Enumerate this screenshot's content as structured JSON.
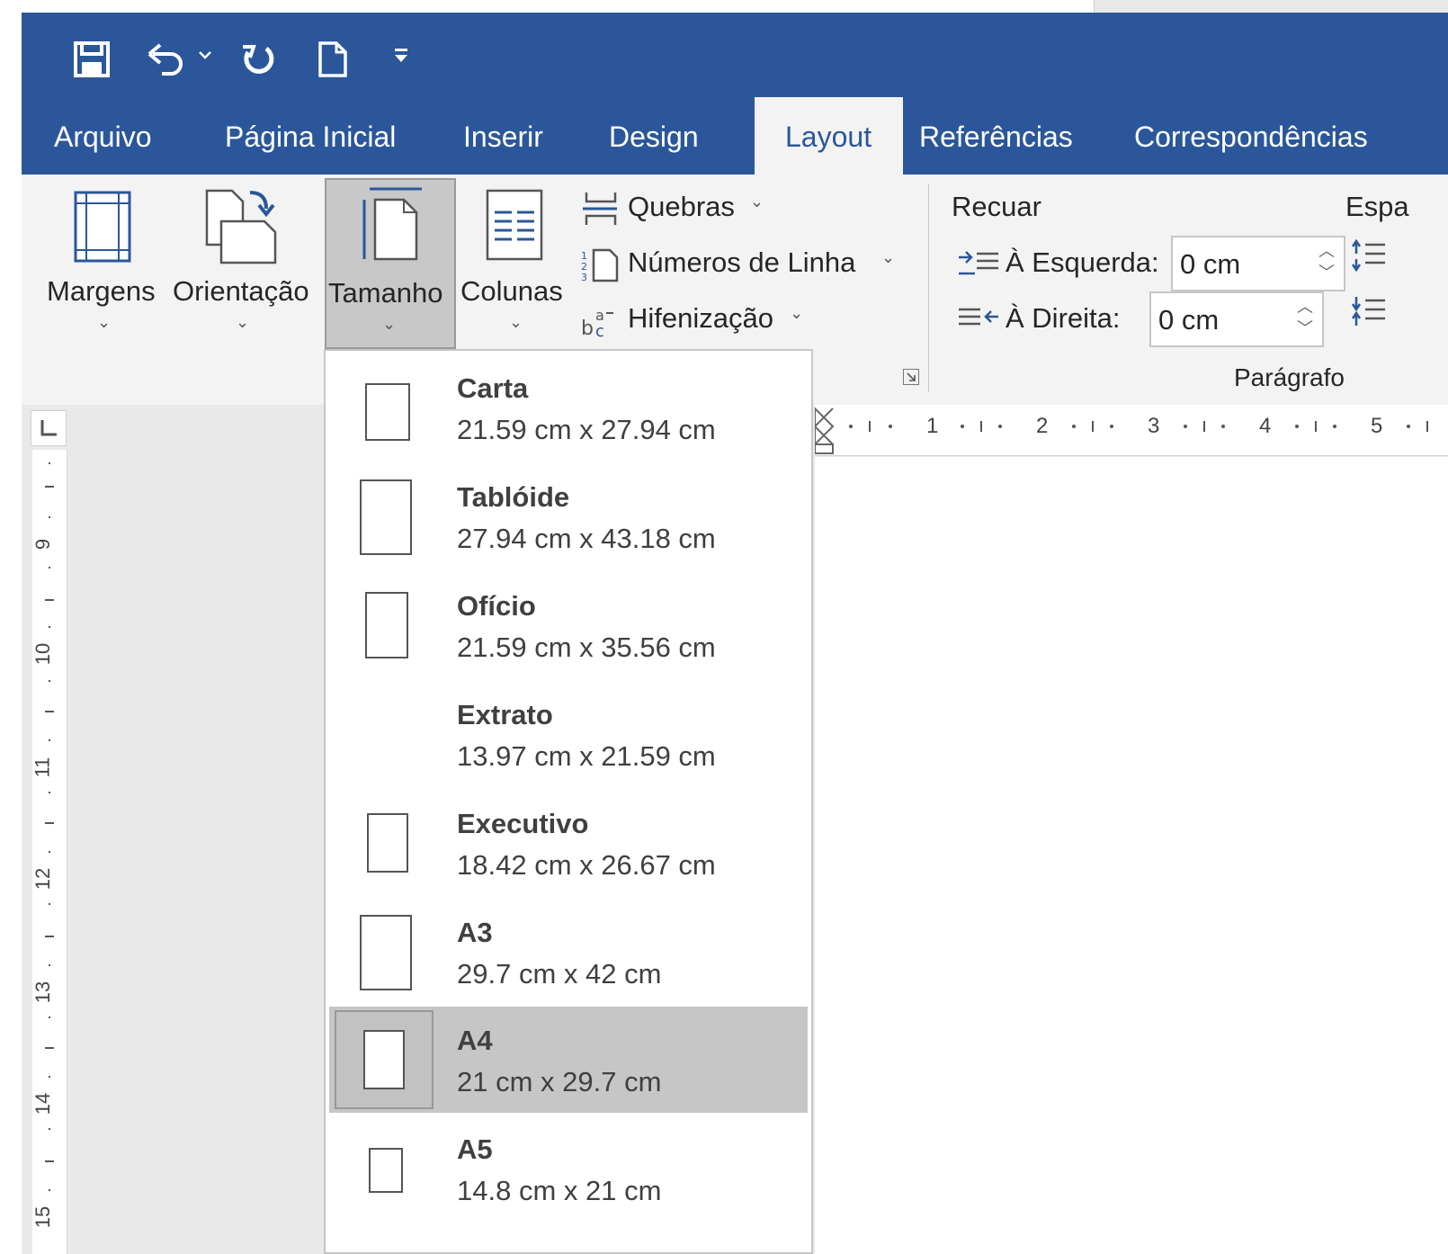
{
  "quick_access": {
    "icons": [
      "save-icon",
      "undo-icon",
      "redo-icon",
      "new-document-icon",
      "customize-qat-icon"
    ]
  },
  "tabs": [
    {
      "label": "Arquivo"
    },
    {
      "label": "Página Inicial"
    },
    {
      "label": "Inserir"
    },
    {
      "label": "Design"
    },
    {
      "label": "Layout"
    },
    {
      "label": "Referências"
    },
    {
      "label": "Correspondências"
    }
  ],
  "ribbon": {
    "margens": "Margens",
    "orientacao": "Orientação",
    "tamanho": "Tamanho",
    "colunas": "Colunas",
    "quebras": "Quebras",
    "numeros_linha": "Números de Linha",
    "hifenizacao": "Hifenização",
    "recuar": "Recuar",
    "esquerda_label": "À Esquerda:",
    "esquerda_value": "0 cm",
    "direita_label": "À Direita:",
    "direita_value": "0 cm",
    "espacamento": "Espa",
    "paragrafo": "Parágrafo"
  },
  "ruler": {
    "h_marks": [
      "1",
      "2",
      "3",
      "4",
      "5"
    ],
    "v_marks": [
      "9",
      "10",
      "11",
      "12",
      "13",
      "14",
      "15"
    ]
  },
  "size_menu": {
    "items": [
      {
        "name": "Carta",
        "dims": "21.59 cm x 27.94 cm",
        "selected": false
      },
      {
        "name": "Tablóide",
        "dims": "27.94 cm x 43.18 cm",
        "selected": false
      },
      {
        "name": "Ofício",
        "dims": "21.59 cm x 35.56 cm",
        "selected": false
      },
      {
        "name": "Extrato",
        "dims": "13.97 cm x 21.59 cm",
        "selected": false
      },
      {
        "name": "Executivo",
        "dims": "18.42 cm x 26.67 cm",
        "selected": false
      },
      {
        "name": "A3",
        "dims": "29.7 cm x 42 cm",
        "selected": false
      },
      {
        "name": "A4",
        "dims": "21 cm x 29.7 cm",
        "selected": true
      },
      {
        "name": "A5",
        "dims": "14.8 cm x 21 cm",
        "selected": false
      }
    ]
  },
  "colors": {
    "titlebar": "#2b579a",
    "ribbon": "#f3f3f3",
    "selected_item": "#c6c6c6"
  }
}
